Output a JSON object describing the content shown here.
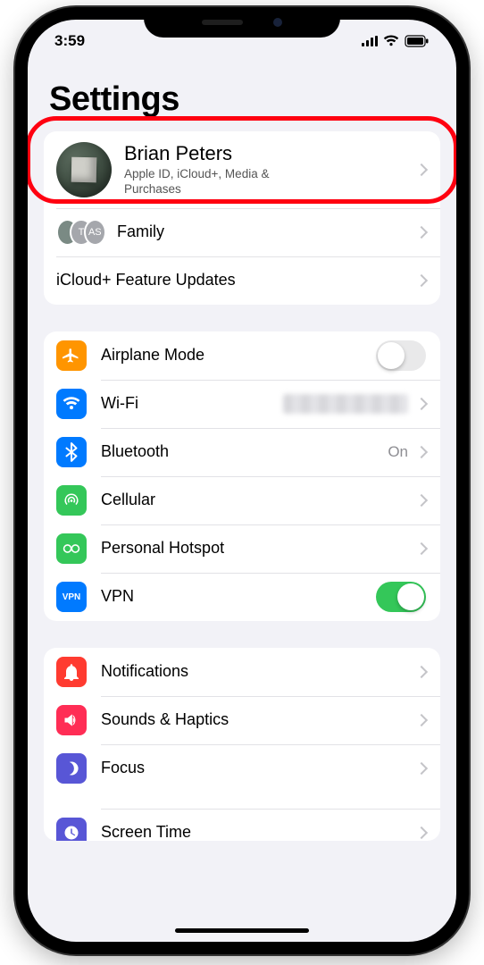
{
  "status": {
    "time": "3:59"
  },
  "page": {
    "title": "Settings"
  },
  "account": {
    "name": "Brian Peters",
    "subtitle": "Apple ID, iCloud+, Media & Purchases",
    "family_label": "Family",
    "family_initials": [
      "",
      "T",
      "AS"
    ],
    "icloud_feature": "iCloud+ Feature Updates"
  },
  "group1": {
    "airplane": {
      "label": "Airplane Mode",
      "on": false
    },
    "wifi": {
      "label": "Wi-Fi"
    },
    "bluetooth": {
      "label": "Bluetooth",
      "value": "On"
    },
    "cellular": {
      "label": "Cellular"
    },
    "hotspot": {
      "label": "Personal Hotspot"
    },
    "vpn": {
      "label": "VPN",
      "on": true
    }
  },
  "group2": {
    "notifications": {
      "label": "Notifications"
    },
    "sounds": {
      "label": "Sounds & Haptics"
    },
    "focus": {
      "label": "Focus"
    },
    "screentime": {
      "label": "Screen Time"
    }
  },
  "colors": {
    "orange": "#ff9500",
    "blue": "#007aff",
    "green": "#34c759",
    "greenCell": "#32d158",
    "greenHotspot": "#30d158",
    "red": "#ff3b30",
    "pink": "#ff2d55",
    "indigo": "#5856d6"
  }
}
